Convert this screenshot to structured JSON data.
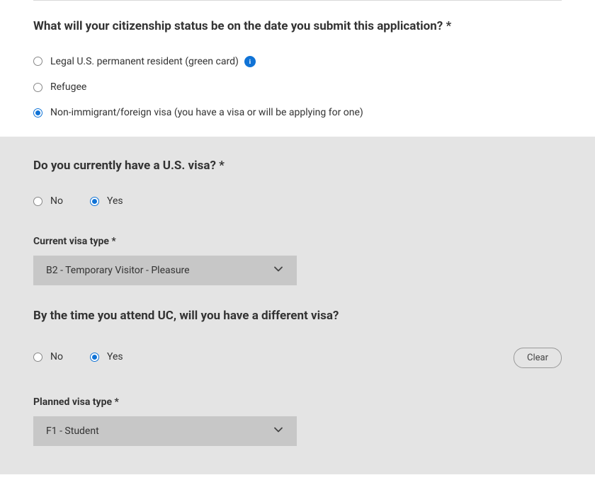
{
  "citizenship": {
    "question": "What will your citizenship status be on the date you submit this application? *",
    "options": {
      "legal_permanent": "Legal U.S. permanent resident (green card)",
      "refugee": "Refugee",
      "non_immigrant": "Non-immigrant/foreign visa (you have a visa or will be applying for one)"
    },
    "info_glyph": "i"
  },
  "has_visa": {
    "question": "Do you currently have a U.S. visa? *",
    "no": "No",
    "yes": "Yes"
  },
  "current_visa": {
    "label": "Current visa type *",
    "value": "B2 - Temporary Visitor - Pleasure"
  },
  "diff_visa": {
    "question": "By the time you attend UC, will you have a different visa?",
    "no": "No",
    "yes": "Yes",
    "clear": "Clear"
  },
  "planned_visa": {
    "label": "Planned visa type *",
    "value": "F1 - Student"
  }
}
